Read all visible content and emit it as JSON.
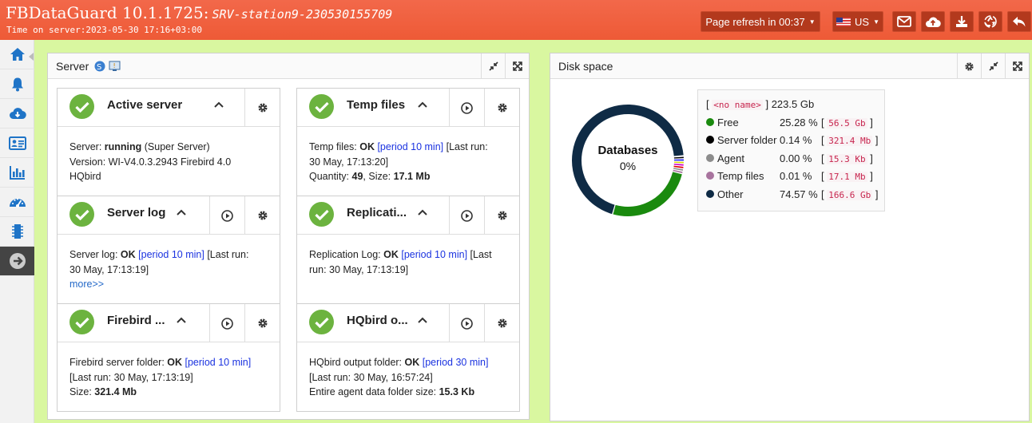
{
  "header": {
    "app_name": "FBDataGuard 10.1.1725:",
    "server_name": "SRV-station9-230530155709",
    "server_time": "Time on server:2023-05-30 17:16+03:00",
    "refresh_label": "Page refresh in 00:37",
    "language": "US",
    "icons": [
      "envelope-icon",
      "cloud-upload-icon",
      "download-icon",
      "recycle-icon",
      "reply-icon"
    ]
  },
  "sidebar": {
    "items": [
      "home-icon",
      "bell-icon",
      "cloud-download-icon",
      "id-card-icon",
      "bar-chart-icon",
      "dashboard-icon",
      "chip-icon",
      "arrow-right-circle-icon"
    ]
  },
  "server_panel": {
    "title": "Server",
    "cards": [
      {
        "title": "Active server",
        "line1_prefix": "Server: ",
        "line1_bold": "running",
        "line1_suffix": " (Super Server)",
        "line2": "Version: WI-V4.0.3.2943 Firebird 4.0",
        "line3": "HQbird"
      },
      {
        "title": "Temp files",
        "prefix": "Temp files: ",
        "status": "OK",
        "period": "[period 10 min]",
        "lastrun": " [Last run:",
        "lastrun2": "30 May, 17:13:20]",
        "qty_label": "Quantity: ",
        "qty": "49",
        "size_label": ", Size: ",
        "size": "17.1 Mb"
      },
      {
        "title": "Server log",
        "prefix": "Server log: ",
        "status": "OK",
        "period": "[period 10 min]",
        "lastrun": " [Last run:",
        "lastrun2": "30 May, 17:13:19]",
        "more": "more>>"
      },
      {
        "title": "Replicati...",
        "prefix": "Replication Log: ",
        "status": "OK",
        "period": "[period 10 min]",
        "lastrun": " [Last",
        "lastrun2": "run: 30 May, 17:13:19]"
      },
      {
        "title": "Firebird ...",
        "prefix": "Firebird server folder: ",
        "status": "OK",
        "period": "[period 10 min]",
        "lastrun2": "[Last run: 30 May, 17:13:19]",
        "size_label": "Size: ",
        "size": "321.4 Mb"
      },
      {
        "title": "HQbird o...",
        "prefix": "HQbird output folder: ",
        "status": "OK",
        "period": "[period 30 min]",
        "lastrun2": "[Last run: 30 May, 16:57:24]",
        "size_label": "Entire agent data folder size: ",
        "size": "15.3 Kb"
      }
    ]
  },
  "disk_panel": {
    "title": "Disk space",
    "donut_label": "Databases",
    "donut_value": "0%",
    "legend_header_name": "<no name>",
    "legend_header_total": "223.5 Gb",
    "legend": [
      {
        "name": "Free",
        "percent": "25.28 %",
        "value": "56.5 Gb",
        "color": "#1a8a0e",
        "fraction": 0.2528
      },
      {
        "name": "Server folder",
        "percent": "0.14 %",
        "value": "321.4 Mb",
        "color": "#000000",
        "fraction": 0.0014
      },
      {
        "name": "Agent",
        "percent": "0.00 %",
        "value": "15.3 Kb",
        "color": "#8c8c8c",
        "fraction": 0.0
      },
      {
        "name": "Temp files",
        "percent": "0.01 %",
        "value": "17.1 Mb",
        "color": "#a8749e",
        "fraction": 0.0001
      },
      {
        "name": "Other",
        "percent": "74.57 %",
        "value": "166.6 Gb",
        "color": "#0f2b45",
        "fraction": 0.7457
      }
    ]
  }
}
